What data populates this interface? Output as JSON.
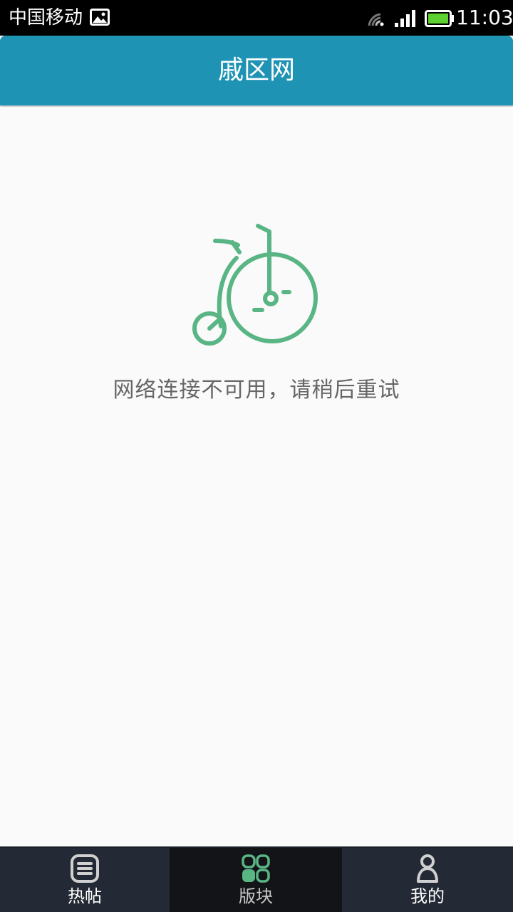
{
  "status_bar": {
    "carrier": "中国移动",
    "time": "11:03",
    "icons": [
      "image-notification-icon",
      "wifi-icon",
      "signal-icon",
      "battery-icon"
    ]
  },
  "header": {
    "title": "戚区网"
  },
  "main": {
    "illustration": "penny-farthing-bicycle-icon",
    "error_message": "网络连接不可用，请稍后重试"
  },
  "tab_bar": {
    "tabs": [
      {
        "label": "热帖",
        "icon": "list-icon",
        "active": false
      },
      {
        "label": "版块",
        "icon": "grid-icon",
        "active": true
      },
      {
        "label": "我的",
        "icon": "user-icon",
        "active": false
      }
    ]
  },
  "colors": {
    "header_bg": "#1e93b4",
    "accent_green": "#5ab585",
    "tab_bar_bg": "#242a35",
    "tab_active_bg": "#121417"
  }
}
